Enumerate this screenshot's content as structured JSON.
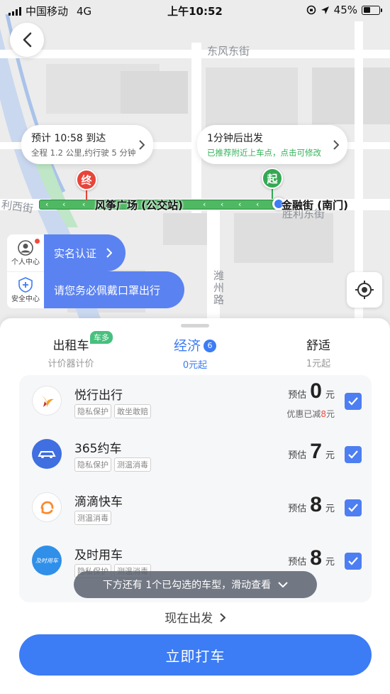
{
  "status_bar": {
    "carrier": "中国移动",
    "network": "4G",
    "time": "上午10:52",
    "battery": "45%",
    "battery_level": 0.45
  },
  "map": {
    "streets": [
      "东风东街",
      "利西街",
      "胜利东街",
      "潍州路"
    ],
    "eta_bubble": {
      "title": "预计 10:58 到达",
      "detail": "全程 1.2 公里,约行驶 5 分钟"
    },
    "start_bubble": {
      "title": "1分钟后出发",
      "detail": "已推荐附近上车点，点击可修改"
    },
    "end_pin": "终",
    "start_pin": "起",
    "end_place": "风筝广场 (公交站)",
    "start_place": "金融街 (南门)"
  },
  "side": {
    "personal_center": "个人中心",
    "safety_center": "安全中心",
    "verify": "实名认证",
    "mask_notice": "请您务必佩戴口罩出行"
  },
  "tabs": [
    {
      "name": "出租车",
      "sub": "计价器计价",
      "badge": "车多"
    },
    {
      "name": "经济",
      "sub": "0元起",
      "count": "6"
    },
    {
      "name": "舒适",
      "sub": "1元起"
    }
  ],
  "options": [
    {
      "name": "悦行出行",
      "tags": [
        "隐私保护",
        "敢坐敢赔"
      ],
      "pre": "预估",
      "price": "0",
      "unit": "元",
      "discount_pre": "优惠已减",
      "discount_value": "8",
      "discount_unit": "元",
      "logo_color": "#f3a12b"
    },
    {
      "name": "365约车",
      "tags": [
        "隐私保护",
        "测温消毒"
      ],
      "pre": "预估",
      "price": "7",
      "unit": "元",
      "logo_color": "#3f6fe0"
    },
    {
      "name": "滴滴快车",
      "tags": [
        "测温消毒"
      ],
      "pre": "预估",
      "price": "8",
      "unit": "元",
      "logo_color": "#fb8a2c"
    },
    {
      "name": "及时用车",
      "tags": [
        "隐私保护",
        "测温消毒"
      ],
      "pre": "预估",
      "price": "8",
      "unit": "元",
      "logo_color": "#2f8fe9",
      "logo_text": "及时用车"
    }
  ],
  "more_toast": "下方还有 1个已勾选的车型，滑动查看",
  "depart_now": "现在出发",
  "call_button": "立即打车",
  "colors": {
    "primary": "#3c7cf5",
    "route": "#4fb863",
    "end_pin": "#e8443a",
    "start_pin": "#35a853"
  }
}
